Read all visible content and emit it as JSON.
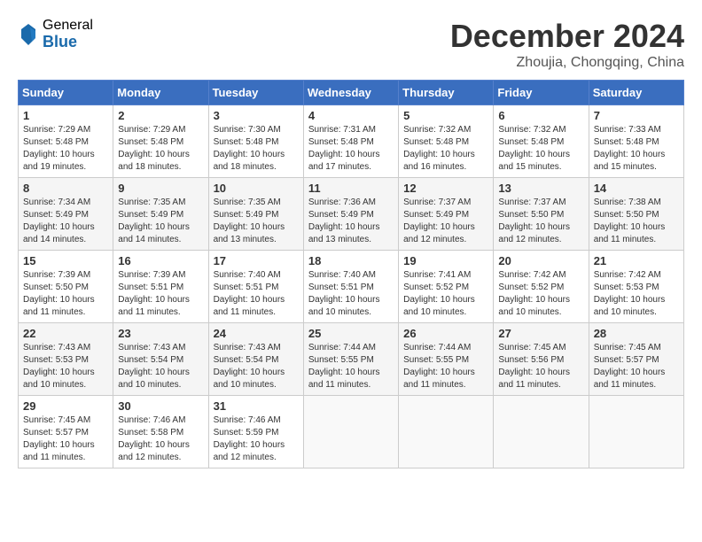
{
  "header": {
    "logo_general": "General",
    "logo_blue": "Blue",
    "title": "December 2024",
    "location": "Zhoujia, Chongqing, China"
  },
  "weekdays": [
    "Sunday",
    "Monday",
    "Tuesday",
    "Wednesday",
    "Thursday",
    "Friday",
    "Saturday"
  ],
  "weeks": [
    [
      {
        "day": 1,
        "sunrise": "7:29 AM",
        "sunset": "5:48 PM",
        "daylight": "10 hours and 19 minutes."
      },
      {
        "day": 2,
        "sunrise": "7:29 AM",
        "sunset": "5:48 PM",
        "daylight": "10 hours and 18 minutes."
      },
      {
        "day": 3,
        "sunrise": "7:30 AM",
        "sunset": "5:48 PM",
        "daylight": "10 hours and 18 minutes."
      },
      {
        "day": 4,
        "sunrise": "7:31 AM",
        "sunset": "5:48 PM",
        "daylight": "10 hours and 17 minutes."
      },
      {
        "day": 5,
        "sunrise": "7:32 AM",
        "sunset": "5:48 PM",
        "daylight": "10 hours and 16 minutes."
      },
      {
        "day": 6,
        "sunrise": "7:32 AM",
        "sunset": "5:48 PM",
        "daylight": "10 hours and 15 minutes."
      },
      {
        "day": 7,
        "sunrise": "7:33 AM",
        "sunset": "5:48 PM",
        "daylight": "10 hours and 15 minutes."
      }
    ],
    [
      {
        "day": 8,
        "sunrise": "7:34 AM",
        "sunset": "5:49 PM",
        "daylight": "10 hours and 14 minutes."
      },
      {
        "day": 9,
        "sunrise": "7:35 AM",
        "sunset": "5:49 PM",
        "daylight": "10 hours and 14 minutes."
      },
      {
        "day": 10,
        "sunrise": "7:35 AM",
        "sunset": "5:49 PM",
        "daylight": "10 hours and 13 minutes."
      },
      {
        "day": 11,
        "sunrise": "7:36 AM",
        "sunset": "5:49 PM",
        "daylight": "10 hours and 13 minutes."
      },
      {
        "day": 12,
        "sunrise": "7:37 AM",
        "sunset": "5:49 PM",
        "daylight": "10 hours and 12 minutes."
      },
      {
        "day": 13,
        "sunrise": "7:37 AM",
        "sunset": "5:50 PM",
        "daylight": "10 hours and 12 minutes."
      },
      {
        "day": 14,
        "sunrise": "7:38 AM",
        "sunset": "5:50 PM",
        "daylight": "10 hours and 11 minutes."
      }
    ],
    [
      {
        "day": 15,
        "sunrise": "7:39 AM",
        "sunset": "5:50 PM",
        "daylight": "10 hours and 11 minutes."
      },
      {
        "day": 16,
        "sunrise": "7:39 AM",
        "sunset": "5:51 PM",
        "daylight": "10 hours and 11 minutes."
      },
      {
        "day": 17,
        "sunrise": "7:40 AM",
        "sunset": "5:51 PM",
        "daylight": "10 hours and 11 minutes."
      },
      {
        "day": 18,
        "sunrise": "7:40 AM",
        "sunset": "5:51 PM",
        "daylight": "10 hours and 10 minutes."
      },
      {
        "day": 19,
        "sunrise": "7:41 AM",
        "sunset": "5:52 PM",
        "daylight": "10 hours and 10 minutes."
      },
      {
        "day": 20,
        "sunrise": "7:42 AM",
        "sunset": "5:52 PM",
        "daylight": "10 hours and 10 minutes."
      },
      {
        "day": 21,
        "sunrise": "7:42 AM",
        "sunset": "5:53 PM",
        "daylight": "10 hours and 10 minutes."
      }
    ],
    [
      {
        "day": 22,
        "sunrise": "7:43 AM",
        "sunset": "5:53 PM",
        "daylight": "10 hours and 10 minutes."
      },
      {
        "day": 23,
        "sunrise": "7:43 AM",
        "sunset": "5:54 PM",
        "daylight": "10 hours and 10 minutes."
      },
      {
        "day": 24,
        "sunrise": "7:43 AM",
        "sunset": "5:54 PM",
        "daylight": "10 hours and 10 minutes."
      },
      {
        "day": 25,
        "sunrise": "7:44 AM",
        "sunset": "5:55 PM",
        "daylight": "10 hours and 11 minutes."
      },
      {
        "day": 26,
        "sunrise": "7:44 AM",
        "sunset": "5:55 PM",
        "daylight": "10 hours and 11 minutes."
      },
      {
        "day": 27,
        "sunrise": "7:45 AM",
        "sunset": "5:56 PM",
        "daylight": "10 hours and 11 minutes."
      },
      {
        "day": 28,
        "sunrise": "7:45 AM",
        "sunset": "5:57 PM",
        "daylight": "10 hours and 11 minutes."
      }
    ],
    [
      {
        "day": 29,
        "sunrise": "7:45 AM",
        "sunset": "5:57 PM",
        "daylight": "10 hours and 11 minutes."
      },
      {
        "day": 30,
        "sunrise": "7:46 AM",
        "sunset": "5:58 PM",
        "daylight": "10 hours and 12 minutes."
      },
      {
        "day": 31,
        "sunrise": "7:46 AM",
        "sunset": "5:59 PM",
        "daylight": "10 hours and 12 minutes."
      },
      null,
      null,
      null,
      null
    ]
  ]
}
